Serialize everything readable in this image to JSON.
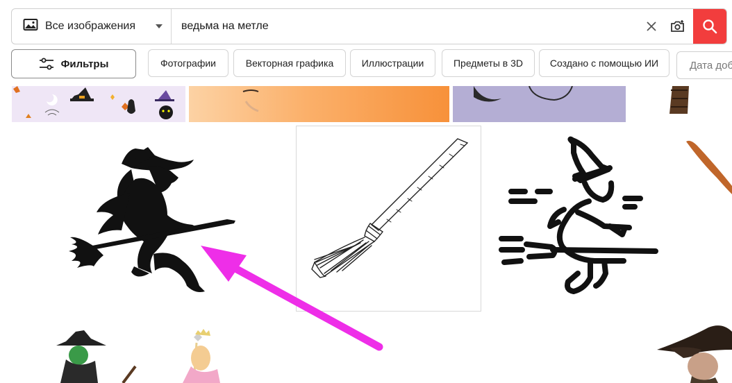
{
  "search": {
    "type_label": "Все изображения",
    "query": "ведьма на метле",
    "icons": [
      "image-icon",
      "close-icon",
      "camera-search-icon",
      "search-icon"
    ]
  },
  "filters": {
    "filters_label": "Фильтры",
    "chips": [
      "Фотографии",
      "Векторная графика",
      "Иллюстрации",
      "Предметы в 3D",
      "Создано с помощью ИИ"
    ],
    "date_label": "Дата доб"
  },
  "colors": {
    "accent": "#f23d3d",
    "arrow": "#ee2ee8"
  }
}
